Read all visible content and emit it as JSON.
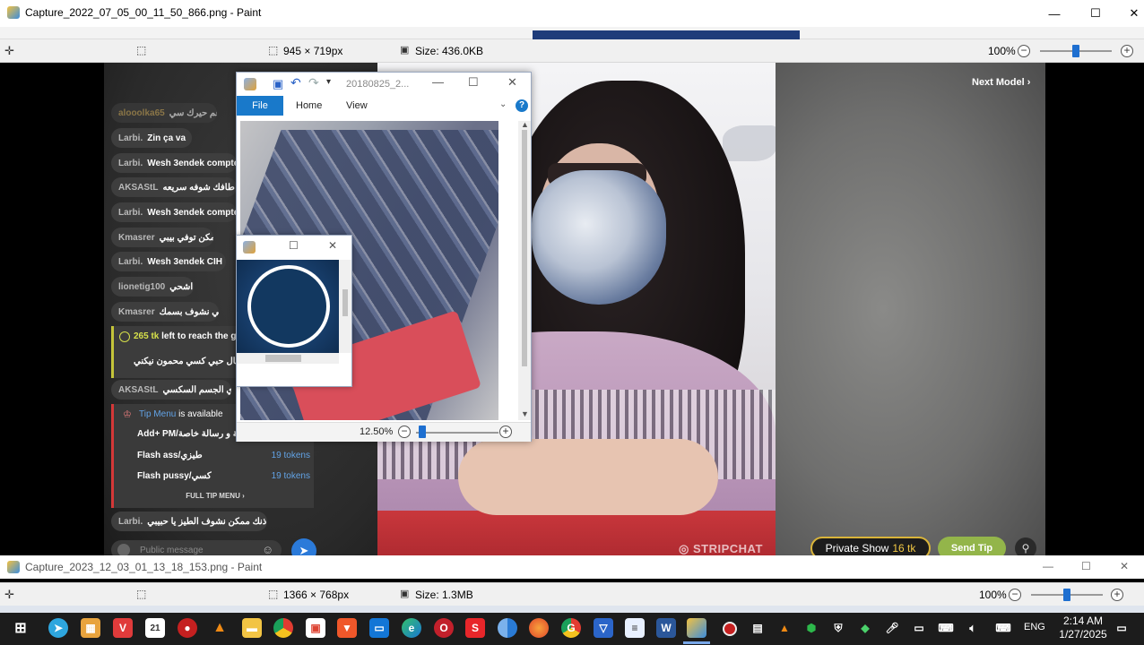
{
  "paint1": {
    "title": "Capture_2022_07_05_00_11_50_866.png - Paint",
    "dimensions": "945 × 719px",
    "size": "Size: 436.0KB",
    "zoom": "100%",
    "zoom_level": 0.5
  },
  "stream": {
    "next_model": "Next Model",
    "watermark": "STRIPCHAT",
    "private_show": "Private Show",
    "private_show_tokens": "16 tk",
    "send_tip": "Send Tip",
    "chat": [
      {
        "user": "alooolka65",
        "msg": "غم حيرك سي"
      },
      {
        "user": "Larbi.",
        "msg": "Zin ça va"
      },
      {
        "user": "Larbi.",
        "msg": "Wesh 3endek compte"
      },
      {
        "user": "AKSAStL",
        "msg": "شوف طافك شوفه سريعه"
      },
      {
        "user": "Larbi.",
        "msg": "Wesh 3endek compte"
      },
      {
        "user": "Kmasrer",
        "msg": "ممكن توفي بيبي"
      },
      {
        "user": "Larbi.",
        "msg": "Wesh 3endek CIH"
      },
      {
        "user": "lionetig100",
        "msg": "اشحي"
      },
      {
        "user": "Kmasrer",
        "msg": "وفي نشوف بسمك"
      }
    ],
    "goal": {
      "tokens": "265 tk",
      "text": "left to reach the g",
      "msg": "تعال حبي كسي محمون نيكني"
    },
    "chat_after": {
      "user": "AKSAStL",
      "msg": "بأبري الجسم السكسي"
    },
    "tip_menu": {
      "header_link": "Tip Menu",
      "header_rest": "is available",
      "items": [
        {
          "label": "Add+ PM/مساكة و رسالة خاصة",
          "tokens": ""
        },
        {
          "label": "Flash ass/طيزي",
          "tokens": "19 tokens"
        },
        {
          "label": "Flash pussy/كسي",
          "tokens": "19 tokens"
        }
      ],
      "full": "FULL TIP MENU"
    },
    "last_msg": {
      "user": "Larbi.",
      "msg": "بعد اذنك ممكن نشوف الطيز يا حبيبي"
    },
    "input_placeholder": "Public message"
  },
  "photo_window": {
    "title": "20180825_2...",
    "tabs": [
      "File",
      "Home",
      "View"
    ],
    "zoom": "12.50%",
    "zoom_level": 0.12
  },
  "paint2": {
    "title": "Capture_2023_12_03_01_13_18_153.png - Paint",
    "dimensions": "1366 × 768px",
    "size": "Size: 1.3MB",
    "zoom": "100%",
    "zoom_level": 0.5
  },
  "taskbar": {
    "icons": [
      "start-icon",
      "telegram-icon",
      "store-icon",
      "vivaldi-icon",
      "calendar-icon",
      "record-icon",
      "vlc-icon",
      "file-explorer-icon",
      "chrome-icon",
      "photos-icon",
      "brave-icon",
      "outlook-icon",
      "edge-icon",
      "opera-icon",
      "app-icon",
      "chrome-canary-icon",
      "firefox-icon",
      "chrome-g-icon",
      "vpn-icon",
      "notepad-icon",
      "word-icon",
      "paint-icon"
    ],
    "language": "ENG",
    "time": "2:14 AM",
    "date": "1/27/2025"
  }
}
